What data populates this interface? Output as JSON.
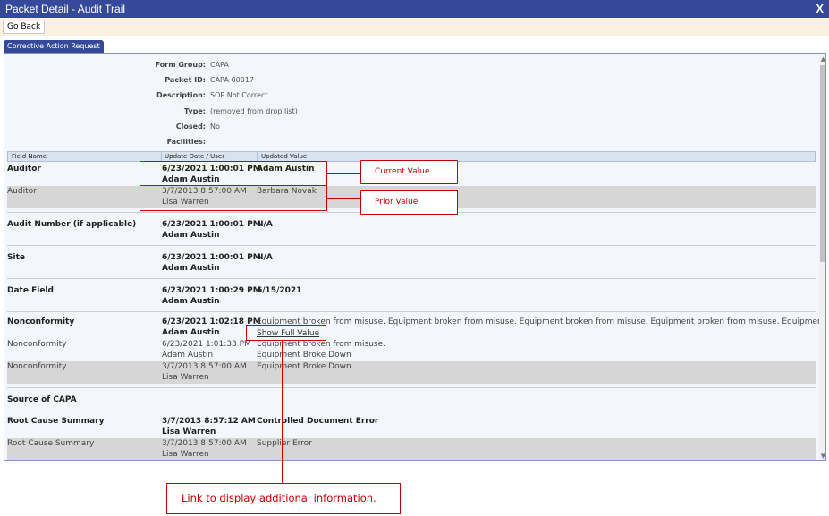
{
  "window": {
    "title": "Packet Detail - Audit Trail",
    "close_label": "X"
  },
  "toolbar": {
    "back_label": "Go Back"
  },
  "tab": {
    "label": "Corrective Action Request"
  },
  "packet": {
    "form_group": {
      "label": "Form Group:",
      "value": "CAPA"
    },
    "packet_id": {
      "label": "Packet ID:",
      "value": "CAPA-00017"
    },
    "description": {
      "label": "Description:",
      "value": "SOP Not Correct"
    },
    "type": {
      "label": "Type:",
      "value": "(removed from drop list)"
    },
    "closed": {
      "label": "Closed:",
      "value": "No"
    },
    "facilities": {
      "label": "Facilities:",
      "value": ""
    }
  },
  "grid": {
    "columns": [
      "Field Name",
      "Update Date / User",
      "Updated Value"
    ],
    "rows": [
      {
        "field": "Auditor",
        "date": "6/23/2021 1:00:01 PM",
        "user": "Adam Austin",
        "value": "Adam Austin",
        "value2": ""
      },
      {
        "field": "Auditor",
        "date": "3/7/2013 8:57:00 AM",
        "user": "Lisa Warren",
        "value": "Barbara Novak",
        "value2": ""
      },
      {
        "field": "Audit Number (if applicable)",
        "date": "6/23/2021 1:00:01 PM",
        "user": "Adam Austin",
        "value": "N/A",
        "value2": ""
      },
      {
        "field": "Site",
        "date": "6/23/2021 1:00:01 PM",
        "user": "Adam Austin",
        "value": "N/A",
        "value2": ""
      },
      {
        "field": "Date Field",
        "date": "6/23/2021 1:00:29 PM",
        "user": "Adam Austin",
        "value": "6/15/2021",
        "value2": ""
      },
      {
        "field": "Nonconformity",
        "date": "6/23/2021 1:02:18 PM",
        "user": "Adam Austin",
        "value": "Equipment broken from misuse. Equipment broken from misuse. Equipment broken from misuse. Equipment broken from misuse. Equipment broken fro",
        "value2": ""
      },
      {
        "field": "Nonconformity",
        "date": "6/23/2021 1:01:33 PM",
        "user": "Adam Austin",
        "value": "Equipment broken from misuse.",
        "value2": "Equipment Broke Down"
      },
      {
        "field": "Nonconformity",
        "date": "3/7/2013 8:57:00 AM",
        "user": "Lisa Warren",
        "value": "Equipment Broke Down",
        "value2": ""
      },
      {
        "field": "Source of CAPA",
        "date": "",
        "user": "",
        "value": "",
        "value2": ""
      },
      {
        "field": "Root Cause Summary",
        "date": "3/7/2013 8:57:12 AM",
        "user": "Lisa Warren",
        "value": "Controlled Document Error",
        "value2": ""
      },
      {
        "field": "Root Cause Summary",
        "date": "3/7/2013 8:57:00 AM",
        "user": "Lisa Warren",
        "value": "Supplier Error",
        "value2": ""
      }
    ],
    "show_full_label": "Show Full Value"
  },
  "annotations": {
    "current_value": "Current Value",
    "prior_value": "Prior Value",
    "link_info": "Link to display additional information."
  },
  "colors": {
    "titlebar": "#34499a",
    "toolbar": "#fcf0e1",
    "annotation_red": "#c40000",
    "row_shade": "#d6d6d6"
  },
  "icons": {
    "scroll_up": "triangle-up",
    "scroll_down": "triangle-down"
  }
}
